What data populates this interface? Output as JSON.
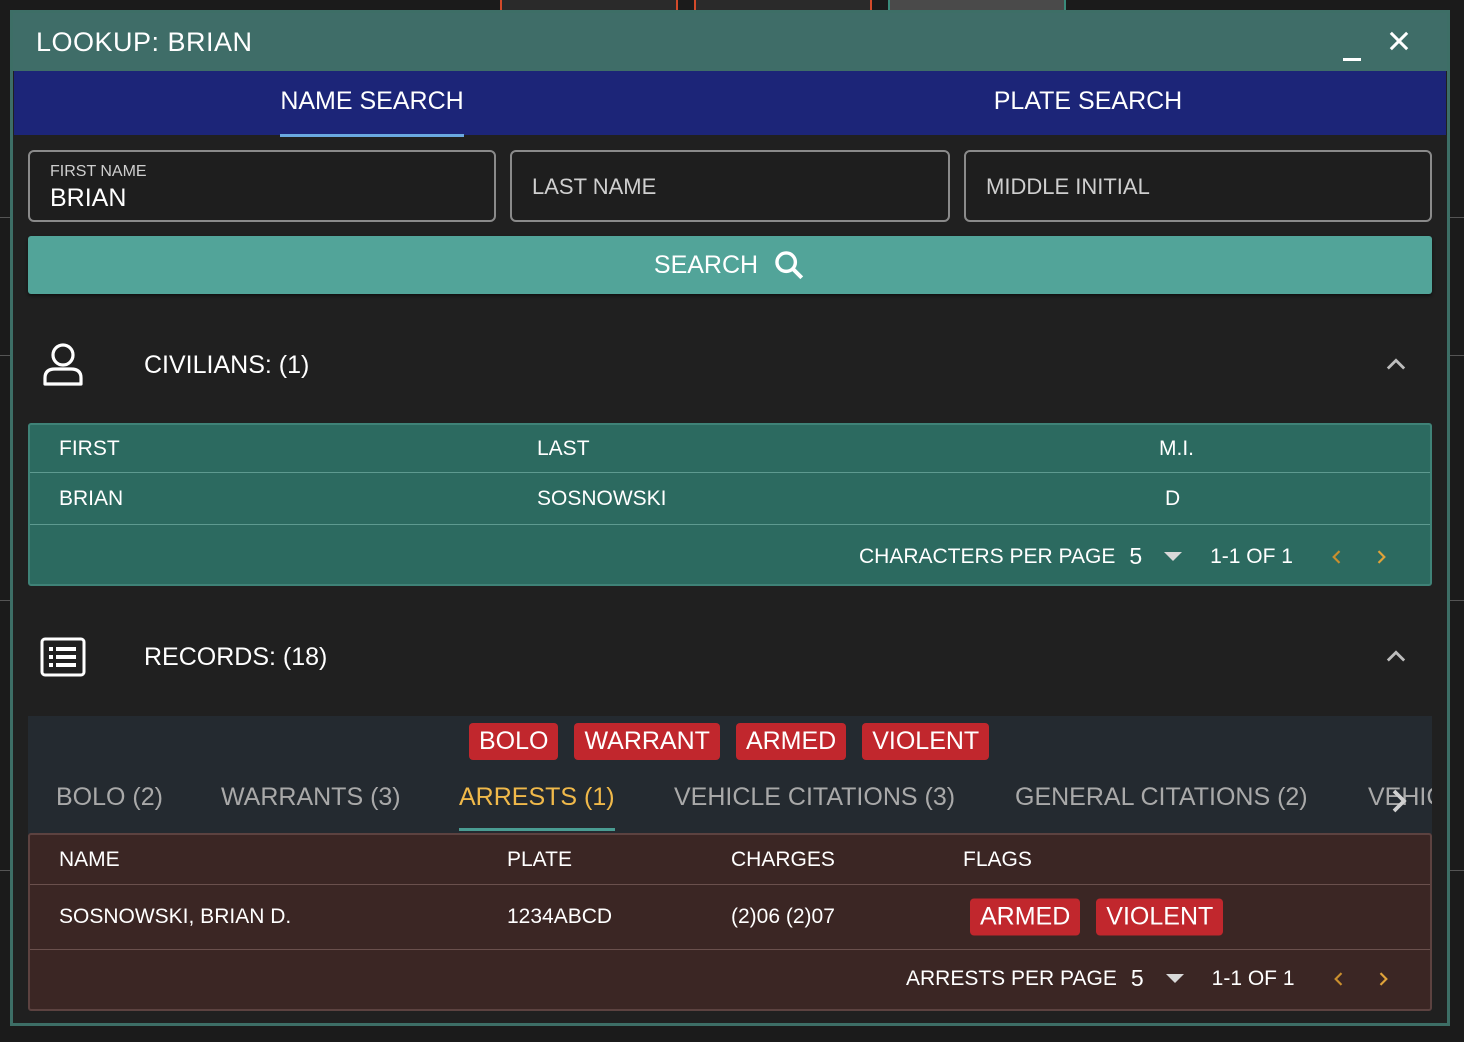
{
  "window": {
    "title": "LOOKUP: BRIAN"
  },
  "tabs": [
    {
      "label": "NAME SEARCH",
      "active": true
    },
    {
      "label": "PLATE SEARCH",
      "active": false
    }
  ],
  "fields": {
    "first_name": {
      "label": "FIRST NAME",
      "value": "BRIAN"
    },
    "last_name": {
      "placeholder": "LAST NAME"
    },
    "middle_initial": {
      "placeholder": "MIDDLE INITIAL"
    }
  },
  "search_button": {
    "label": "SEARCH",
    "icon": "search-icon"
  },
  "civilians": {
    "title": "CIVILIANS: (1)",
    "icon": "person-icon",
    "columns": [
      "FIRST",
      "LAST",
      "M.I."
    ],
    "rows": [
      [
        "BRIAN",
        "SOSNOWSKI",
        "D"
      ]
    ],
    "pager": {
      "label": "CHARACTERS PER PAGE",
      "per_page": "5",
      "range": "1-1 OF 1"
    }
  },
  "records": {
    "title": "RECORDS: (18)",
    "icon": "list-icon",
    "flags": [
      "BOLO",
      "WARRANT",
      "ARMED",
      "VIOLENT"
    ],
    "tabs": [
      {
        "label": "BOLO (2)",
        "active": false
      },
      {
        "label": "WARRANTS (3)",
        "active": false
      },
      {
        "label": "ARRESTS (1)",
        "active": true
      },
      {
        "label": "VEHICLE CITATIONS (3)",
        "active": false
      },
      {
        "label": "GENERAL CITATIONS (2)",
        "active": false
      },
      {
        "label": "VEHIC",
        "active": false
      }
    ]
  },
  "arrests": {
    "columns": [
      "NAME",
      "PLATE",
      "CHARGES",
      "FLAGS"
    ],
    "rows": [
      {
        "name": "SOSNOWSKI, BRIAN D.",
        "plate": "1234ABCD",
        "charges": "(2)06 (2)07",
        "flags": [
          "ARMED",
          "VIOLENT"
        ]
      }
    ],
    "pager": {
      "label": "ARRESTS PER PAGE",
      "per_page": "5",
      "range": "1-1 OF 1"
    }
  },
  "colors": {
    "titlebar": "#3f6d68",
    "tabs_bg": "#1c2578",
    "accent_teal": "#52a499",
    "flag_red": "#c1272d",
    "active_tab": "#f0b94a",
    "arrests_bg": "#3b2624"
  }
}
